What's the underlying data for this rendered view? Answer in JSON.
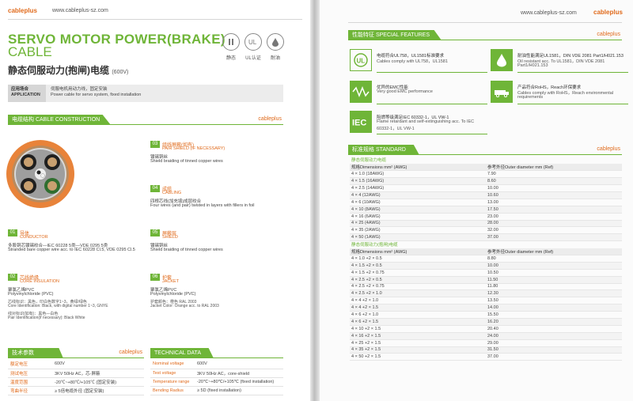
{
  "left": {
    "logo": "cableplus",
    "url": "www.cableplus-sz.com",
    "title_line1": "SERVO MOTOR POWER(BRAKE)",
    "title_line2": "CABLE",
    "title_cn": "静态伺服动力(抱闸)电缆",
    "title_voltage": "(600V)",
    "badges": [
      "静态",
      "UL认证",
      "耐油"
    ],
    "application": {
      "key_cn": "应用场合",
      "key_en": "APPLICATION",
      "val_cn": "伺服电机用动力线，固定安装",
      "val_en": "Power cable for servo system, fixed installation"
    },
    "construction_title": "电缆结构 CABLE CONSTRUCTION",
    "brand": "cableplus",
    "components": [
      {
        "num": "03",
        "cn": "组线屏蔽(如有)",
        "en": "PAIR SHIELD (IF NECESSARY)",
        "d1": "镀锡铜丝",
        "d2": "Shield braiding of tinned copper wires"
      },
      {
        "num": "04",
        "cn": "成缆",
        "en": "CABLING",
        "d1": "四根芯线(加充填)成层绞合",
        "d2": "Four wires (and pair) twisted in layers with fillers in foil"
      },
      {
        "num": "01",
        "cn": "导体",
        "en": "CONDUCTOR",
        "d1": "多股铜芯镀锡绞合—IEC 60228 5类—VDE 0295 5类",
        "d2": "Stranded bare copper wire acc. to IEC 60228 Cl.5, VDE 0295 Cl.5"
      },
      {
        "num": "05",
        "cn": "屏蔽层",
        "en": "SHIELD",
        "d1": "镀锡铜丝",
        "d2": "Shield braiding of tinned copper wires"
      },
      {
        "num": "02",
        "cn": "芯线绝缘",
        "en": "CORE INSULATION",
        "d1": "聚氯乙烯PVC",
        "d2": "Polyvinylchloride (PVC)",
        "d3": "芯线标识：黑色，印白色数字1~3，黄绿/绿色",
        "d4": "Core Identification: Black, with digital number 1~3, GNYE",
        "d5": "线对标识(如有)：黑色—白色",
        "d6": "Pair Identification(if necessary): Black White"
      },
      {
        "num": "06",
        "cn": "护套",
        "en": "JACKET",
        "d1": "聚氯乙烯PVC",
        "d2": "Polyvinylchloride (PVC)",
        "d3": "护套颜色：橙色 RAL 2003",
        "d4": "Jacket Color: Orange acc. to RAL 2003"
      }
    ],
    "tech_cn_title": "技术参数",
    "tech_en_title": "TECHNICAL DATA",
    "tech_cn": [
      [
        "额定电压",
        "600V"
      ],
      [
        "测试电压",
        "3KV 50Hz AC，芯-屏蔽"
      ],
      [
        "温度范围",
        "-20℃~+80℃/+105℃ (固定安装)"
      ],
      [
        "弯曲半径",
        "≥ 5倍电缆外径 (固定安装)"
      ]
    ],
    "tech_en": [
      [
        "Nominal voltage",
        "600V"
      ],
      [
        "Test voltage",
        "3KV 50Hz AC，core-shield"
      ],
      [
        "Temperature range",
        "-20℃~+80℃/+105℃ (fixed installation)"
      ],
      [
        "Bending Radius",
        "≥ 5D (fixed installation)"
      ]
    ]
  },
  "right": {
    "url": "www.cableplus-sz.com",
    "logo": "cableplus",
    "features_title": "性能特征 SPECIAL FEATURES",
    "brand": "cableplus",
    "features": [
      {
        "icon": "ul-cert-icon",
        "l1": "电缆符合UL758，UL1581标准要求",
        "l2": "Cables comply with UL758，UL1581",
        "l3": ""
      },
      {
        "icon": "oil-drop-icon",
        "l1": "耐油性能满足UL1581，DIN VDE 2081 Part1/H021.153",
        "l2": "Oil resistant acc. To UL1581，DIN VDE 2081",
        "l3": "Part1/H021.153"
      },
      {
        "icon": "emc-icon",
        "l1": "优异的EMC性能",
        "l2": "Very good EMC performance",
        "l3": ""
      },
      {
        "icon": "eco-icon",
        "l1": "产品符合RoHS，Reach环保要求",
        "l2": "Cables comply with RoHS，Reach environmental",
        "l3": "requirements"
      },
      {
        "icon": "iec-icon",
        "l1": "阻燃等级满足IEC 60332-1，UL VW-1",
        "l2": "Flame retardant and self-extinguishing acc. To IEC",
        "l3": "60332-1，UL VW-1"
      }
    ],
    "standard_title": "标准规格 STANDARD",
    "group1_label": "静态伺服动力电缆",
    "group2_label": "静态伺服动力(抱闸)电缆",
    "col1": "规格Dimensions mm² (AWG)",
    "col2": "参考外径Outer diameter mm (Ref)",
    "table1": [
      [
        "4 × 1.0 (18AWG)",
        "7.90"
      ],
      [
        "4 × 1.5 (16AWG)",
        "8.60"
      ],
      [
        "4 × 2.5 (14AWG)",
        "10.00"
      ],
      [
        "4 × 4 (12AWG)",
        "10.60"
      ],
      [
        "4 × 6 (10AWG)",
        "13.00"
      ],
      [
        "4 × 10 (8AWG)",
        "17.50"
      ],
      [
        "4 × 16 (6AWG)",
        "23.00"
      ],
      [
        "4 × 25 (4AWG)",
        "28.00"
      ],
      [
        "4 × 35 (2AWG)",
        "32.00"
      ],
      [
        "4 × 50 (1AWG)",
        "37.00"
      ]
    ],
    "table2": [
      [
        "4 × 1.0 +2 × 0.5",
        "8.80"
      ],
      [
        "4 × 1.5 +2 × 0.5",
        "10.00"
      ],
      [
        "4 × 1.5 +2 × 0.75",
        "10.50"
      ],
      [
        "4 × 2.5 +2 × 0.5",
        "11.50"
      ],
      [
        "4 × 2.5 +2 × 0.75",
        "11.80"
      ],
      [
        "4 × 2.5 +2 × 1.0",
        "12.30"
      ],
      [
        "4 × 4 +2 × 1.0",
        "13.50"
      ],
      [
        "4 × 4 +2 × 1.5",
        "14.00"
      ],
      [
        "4 × 6 +2 × 1.0",
        "15.50"
      ],
      [
        "4 × 6 +2 × 1.5",
        "16.20"
      ],
      [
        "4 × 10 +2 × 1.5",
        "20.40"
      ],
      [
        "4 × 16 +2 × 1.5",
        "24.00"
      ],
      [
        "4 × 25 +2 × 1.5",
        "29.00"
      ],
      [
        "4 × 35 +2 × 1.5",
        "31.50"
      ],
      [
        "4 × 50 +2 × 1.5",
        "37.00"
      ]
    ]
  },
  "colors": {
    "green": "#6fb538",
    "orange": "#e06a1b"
  }
}
